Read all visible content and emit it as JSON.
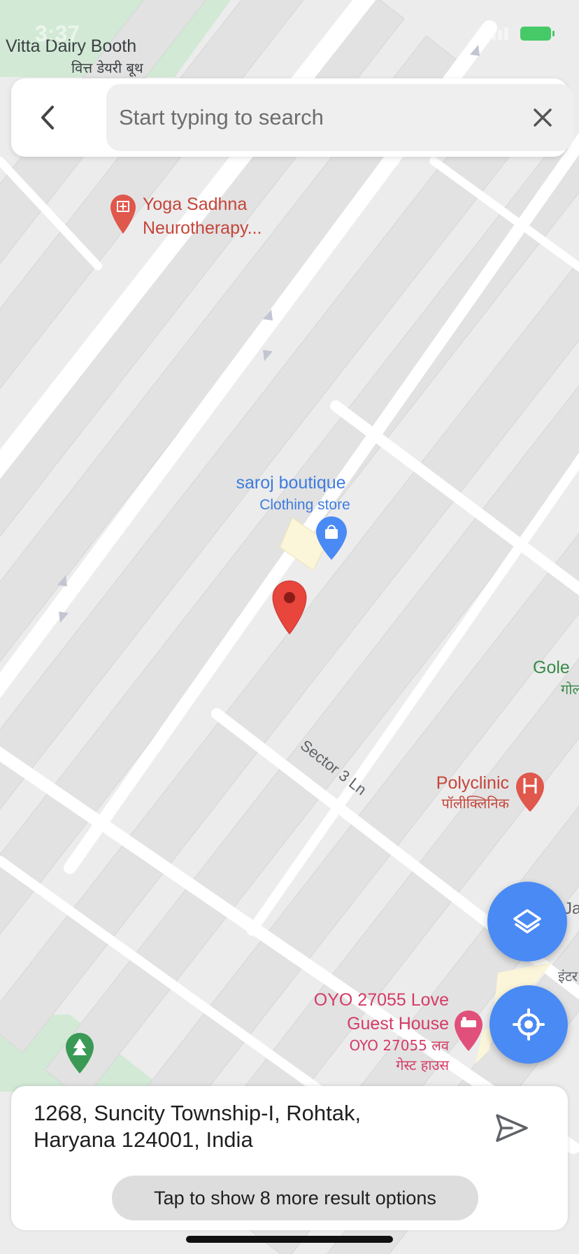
{
  "status_bar": {
    "time": "3:37"
  },
  "search": {
    "placeholder": "Start typing to search",
    "back_icon": "chevron-left-icon",
    "clear_icon": "close-icon"
  },
  "map": {
    "street_label": "Sector 3 Ln",
    "pois": [
      {
        "name": "Vitta Dairy Booth",
        "native": "वित्त डेयरी बूथ",
        "category": ""
      },
      {
        "name": "Yoga Sadhna Neurotherapy...",
        "category": ""
      },
      {
        "name": "saroj boutique",
        "category": "Clothing store"
      },
      {
        "name": "Polyclinic",
        "native": "पॉलीक्लिनिक",
        "category": ""
      },
      {
        "name": "OYO 27055 Love Guest House",
        "native": "OYO 27055 लव गेस्ट हाउस",
        "category": ""
      },
      {
        "name": "Gole",
        "native": "गोल",
        "category": ""
      },
      {
        "name": "Ja",
        "native": "इंटर",
        "category": ""
      }
    ],
    "name_lines": {
      "yoga_1": "Yoga Sadhna",
      "yoga_2": "Neurotherapy...",
      "oyo_1": "OYO 27055 Love",
      "oyo_2": "Guest House",
      "oyo_native_1": "OYO 27055 लव",
      "oyo_native_2": "गेस्ट हाउस"
    },
    "colors": {
      "background": "#ececec",
      "road": "#ffffff",
      "building": "#e1e1e1",
      "park": "#cfe8d3",
      "pin": "#e8453c",
      "boutique_label": "#3d7be0",
      "clinic_label": "#c5453a",
      "hotel_label": "#d43c66",
      "park_label": "#3a8a4a"
    }
  },
  "controls": {
    "layers_icon": "layers-icon",
    "locate_icon": "my-location-icon",
    "accent": "#4a8af4"
  },
  "result": {
    "address": "1268, Suncity Township-I, Rohtak, Haryana 124001, India",
    "address_lines": [
      "1268, Suncity Township-I, Rohtak,",
      "Haryana 124001, India"
    ],
    "more_label": "Tap to show 8 more result options",
    "send_icon": "send-icon"
  }
}
